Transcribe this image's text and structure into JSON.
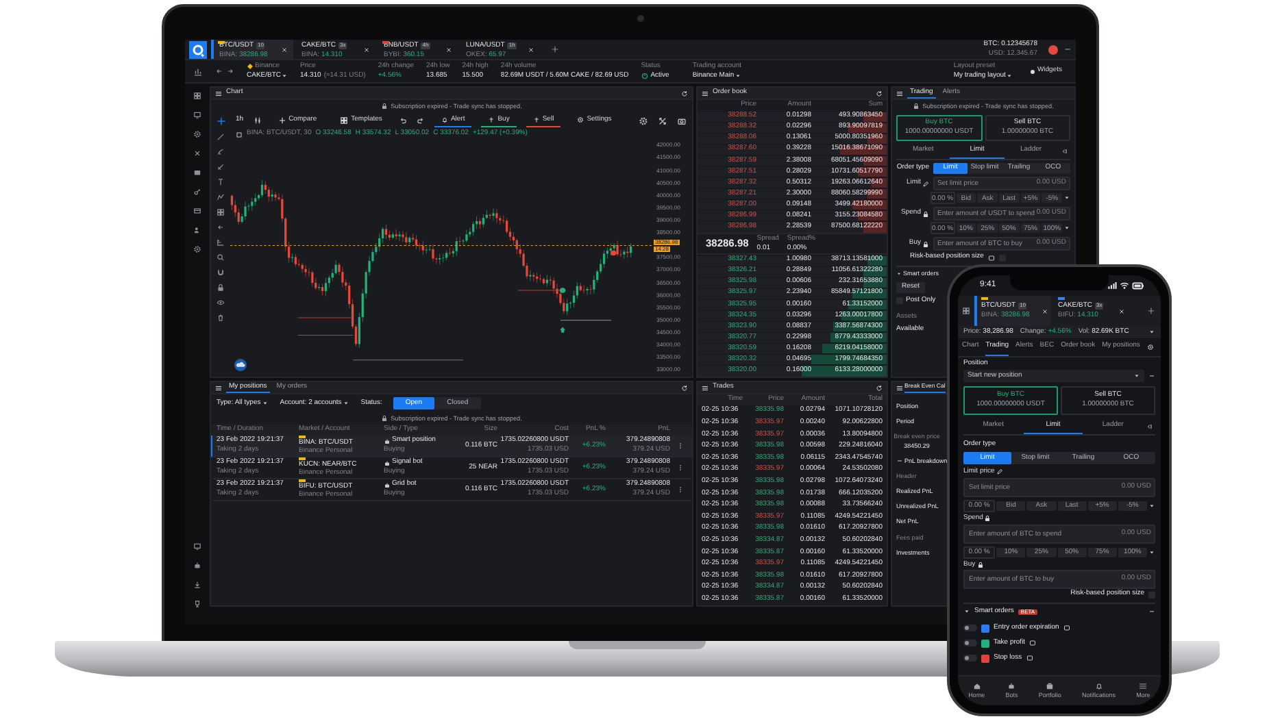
{
  "laptop": {
    "top_tabs": [
      {
        "pair": "BTC/USDT",
        "badge": "10",
        "exchange": "BINA:",
        "price": "38286.98",
        "color": "#f0b90b",
        "selected": true
      },
      {
        "pair": "CAKE/BTC",
        "badge": "3x",
        "exchange": "BINA:",
        "price": "14.310",
        "selected": false
      },
      {
        "pair": "BNB/USDT",
        "badge": "4h",
        "exchange": "BYBI:",
        "price": "360.15",
        "color": "#e0443a",
        "selected": false
      },
      {
        "pair": "LUNA/USDT",
        "badge": "1h",
        "exchange": "OKEX:",
        "price": "65.97",
        "selected": false
      }
    ],
    "balance": [
      "BTC: 0.12345678",
      "USD: 12,345.67"
    ],
    "info_bar": {
      "exchange": "Binance",
      "pair": "CAKE/BTC",
      "stats": [
        {
          "label": "Price",
          "value": "14.310",
          "note": "(≈14.31 USD)",
          "kind": "plain"
        },
        {
          "label": "24h change",
          "value": "+4.56%",
          "kind": "up"
        },
        {
          "label": "24h low",
          "value": "13.685",
          "kind": "plain"
        },
        {
          "label": "24h high",
          "value": "15.500",
          "kind": "plain"
        },
        {
          "label": "24h volume",
          "value": "82.69M USDT / 5.60M CAKE / 82.69 USD",
          "kind": "plain"
        }
      ],
      "status_label": "Status",
      "status": "Active",
      "account_label": "Trading account",
      "account": "Binance Main",
      "layout_label": "Layout preset",
      "layout": "My trading layout",
      "widgets": "Widgets"
    },
    "chart": {
      "title": "Chart",
      "notice": "Subscription expired - Trade sync has stopped.",
      "interval": "1h",
      "tools": [
        "Compare",
        "Templates"
      ],
      "actions": [
        {
          "label": "Alert",
          "kind": "alert"
        },
        {
          "label": "Buy",
          "kind": "buy"
        },
        {
          "label": "Sell",
          "kind": "sell"
        },
        {
          "label": "Settings",
          "kind": "settings"
        }
      ],
      "symbol": "BINA: BTC/USDT, 30",
      "ohlc": [
        "O 33246.58",
        "H 33574.32",
        "L 33050.02",
        "C 33376.02",
        "+129.47 (+0.39%)"
      ],
      "price_axis_upper": [
        "42000.00",
        "41500.00",
        "41000.00",
        "40500.00",
        "40000.00",
        "39500.00",
        "39000.00",
        "38500.00"
      ],
      "price_axis_lower": [
        "37500.00",
        "37000.00",
        "36500.00",
        "36000.00",
        "35500.00",
        "35000.00",
        "34500.00",
        "34000.00",
        "33500.00",
        "33000.00"
      ],
      "last_price": "38286.98",
      "countdown": "14:28"
    },
    "order_book": {
      "title": "Order book",
      "columns": [
        "Price",
        "Amount",
        "Sum"
      ],
      "asks": [
        {
          "price": "38288.52",
          "amount": "0.01298",
          "sum": "493.90863450",
          "level": 0.12
        },
        {
          "price": "38288.32",
          "amount": "0.02296",
          "sum": "893.90097819",
          "level": 0.2
        },
        {
          "price": "38288.06",
          "amount": "0.13061",
          "sum": "5000.80351960",
          "level": 0.1
        },
        {
          "price": "38287.60",
          "amount": "0.39228",
          "sum": "15016.38671090",
          "level": 0.25
        },
        {
          "price": "38287.59",
          "amount": "2.38008",
          "sum": "68051.45609090",
          "level": 0.12
        },
        {
          "price": "38287.51",
          "amount": "0.28029",
          "sum": "10731.60517790",
          "level": 0.15
        },
        {
          "price": "38287.32",
          "amount": "0.50312",
          "sum": "19263.06612640",
          "level": 0.08
        },
        {
          "price": "38287.21",
          "amount": "2.30000",
          "sum": "88060.58299990",
          "level": 0.1
        },
        {
          "price": "38287.00",
          "amount": "0.09148",
          "sum": "3499.42180000",
          "level": 0.18
        },
        {
          "price": "38286.99",
          "amount": "0.08241",
          "sum": "3155.23084580",
          "level": 0.15
        },
        {
          "price": "38286.98",
          "amount": "2.28539",
          "sum": "87500.68122220",
          "level": 0.12
        }
      ],
      "mid": {
        "price": "38286.98",
        "spread_label": "Spread",
        "spread": "0.01",
        "pct_label": "Spread%",
        "pct": "0.00%"
      },
      "bids": [
        {
          "price": "38327.43",
          "amount": "1.00980",
          "sum": "38713.13581000",
          "level": 0.1
        },
        {
          "price": "38326.21",
          "amount": "0.28849",
          "sum": "11056.61322280",
          "level": 0.12
        },
        {
          "price": "38325.98",
          "amount": "0.00606",
          "sum": "232.31653880",
          "level": 0.12
        },
        {
          "price": "38325.97",
          "amount": "2.23940",
          "sum": "85849.57121800",
          "level": 0.18
        },
        {
          "price": "38325.95",
          "amount": "0.00160",
          "sum": "61.33152000",
          "level": 0.2
        },
        {
          "price": "38324.35",
          "amount": "0.03296",
          "sum": "1263.00017800",
          "level": 0.24
        },
        {
          "price": "38323.90",
          "amount": "0.08837",
          "sum": "3387.56874300",
          "level": 0.28
        },
        {
          "price": "38320.77",
          "amount": "0.22998",
          "sum": "8779.43333000",
          "level": 0.3
        },
        {
          "price": "38320.59",
          "amount": "0.16208",
          "sum": "6219.04158000",
          "level": 0.34
        },
        {
          "price": "38320.32",
          "amount": "0.04695",
          "sum": "1799.74684350",
          "level": 0.4
        },
        {
          "price": "38320.00",
          "amount": "0.16000",
          "sum": "6133.28000000",
          "level": 0.45
        }
      ]
    },
    "trading": {
      "tabs": [
        {
          "label": "Trading",
          "selected": true
        },
        {
          "label": "Alerts",
          "selected": false
        }
      ],
      "notice": "Subscription expired - Trade sync has stopped.",
      "sides": [
        {
          "label": "Buy BTC",
          "amount": "1000.00000000 USDT",
          "selected": true
        },
        {
          "label": "Sell BTC",
          "amount": "1.00000000 BTC",
          "selected": false
        }
      ],
      "modes": [
        {
          "label": "Market",
          "selected": false
        },
        {
          "label": "Limit",
          "selected": true
        },
        {
          "label": "Ladder",
          "selected": false
        }
      ],
      "order_type_label": "Order type",
      "order_types": [
        {
          "label": "Limit",
          "selected": true
        },
        {
          "label": "Stop limit",
          "selected": false
        },
        {
          "label": "Trailing",
          "selected": false
        },
        {
          "label": "OCO",
          "selected": false
        }
      ],
      "fields": [
        {
          "label": "Limit",
          "placeholder": "Set limit price",
          "unit": "0.00 USD",
          "chips": [
            "0.00 %",
            "Bid",
            "Ask",
            "Last",
            "+5%",
            "-5%"
          ]
        },
        {
          "label": "Spend",
          "placeholder": "Enter amount of USDT to spend",
          "unit": "0.00 USD",
          "chips": [
            "0.00 %",
            "10%",
            "25%",
            "50%",
            "75%",
            "100%"
          ]
        },
        {
          "label": "Buy",
          "placeholder": "Enter amount of BTC to buy",
          "unit": "0.00 USD"
        }
      ],
      "risk_label": "Risk-based position size",
      "risk_checked": false,
      "smart_orders": "Smart orders",
      "reset": "Reset",
      "post_only": "Post Only",
      "post_only_checked": false,
      "assets": "Assets",
      "available": "Available"
    },
    "positions": {
      "tabs": [
        {
          "label": "My positions",
          "selected": true
        },
        {
          "label": "My orders",
          "selected": false
        }
      ],
      "filters": [
        "Type: All types",
        "Account: 2 accounts"
      ],
      "status_label": "Status:",
      "status_options": [
        {
          "label": "Open",
          "selected": true
        },
        {
          "label": "Closed",
          "selected": false
        }
      ],
      "notice": "Subscription expired - Trade sync has stopped.",
      "columns": [
        "Time / Duration",
        "Market / Account",
        "Side / Type",
        "Size",
        "Cost",
        "PnL %",
        "PnL"
      ],
      "rows": [
        {
          "time": "23 Feb 2022 19:21:37",
          "duration": "Taking 2 days",
          "market": "BINA: BTC/USDT",
          "account": "Binance Personal",
          "color": "#f0b90b",
          "type": "Smart position",
          "side": "Buying",
          "size": "0.116 BTC",
          "cost": "1735.02260800 USDT",
          "cost_usd": "1735.03 USD",
          "pnl_pct": "+6.23%",
          "pnl": "379.24890808",
          "pnl_usd": "379.24 USD",
          "selected": true
        },
        {
          "time": "23 Feb 2022 19:21:37",
          "duration": "Taking 2 days",
          "market": "KUCN: NEAR/BTC",
          "account": "Binance Personal",
          "color": "#f0b90b",
          "type": "Signal bot",
          "side": "Buying",
          "size": "25 NEAR",
          "cost": "1735.02260800 USDT",
          "cost_usd": "1735.03 USD",
          "pnl_pct": "+6.23%",
          "pnl": "379.24890808",
          "pnl_usd": "379.24 USD",
          "selected": false
        },
        {
          "time": "23 Feb 2022 19:21:37",
          "duration": "Taking 2 days",
          "market": "BIFU: BTC/USDT",
          "account": "Binance Personal",
          "color": "#f0b90b",
          "type": "Grid bot",
          "side": "Buying",
          "size": "0.116 BTC",
          "cost": "1735.02260800 USDT",
          "cost_usd": "1735.03 USD",
          "pnl_pct": "+6.23%",
          "pnl": "379.24890808",
          "pnl_usd": "379.24 USD",
          "selected": false
        }
      ]
    },
    "trades": {
      "title": "Trades",
      "columns": [
        "Time",
        "Price",
        "Amount",
        "Total"
      ],
      "rows": [
        {
          "time": "02-25 10:36",
          "price": "38335.98",
          "kind": "buy",
          "amount": "0.02794",
          "total": "1071.10728120"
        },
        {
          "time": "02-25 10:36",
          "price": "38335.97",
          "kind": "sell",
          "amount": "0.00240",
          "total": "92.00622800"
        },
        {
          "time": "02-25 10:36",
          "price": "38335.97",
          "kind": "sell",
          "amount": "0.00036",
          "total": "13.80094800"
        },
        {
          "time": "02-25 10:36",
          "price": "38335.98",
          "kind": "buy",
          "amount": "0.00598",
          "total": "229.24816040"
        },
        {
          "time": "02-25 10:36",
          "price": "38335.98",
          "kind": "buy",
          "amount": "0.06115",
          "total": "2343.47545740"
        },
        {
          "time": "02-25 10:36",
          "price": "38335.97",
          "kind": "sell",
          "amount": "0.00064",
          "total": "24.53502080"
        },
        {
          "time": "02-25 10:36",
          "price": "38335.98",
          "kind": "buy",
          "amount": "0.02798",
          "total": "1072.64073240"
        },
        {
          "time": "02-25 10:36",
          "price": "38335.98",
          "kind": "buy",
          "amount": "0.01738",
          "total": "666.12035200"
        },
        {
          "time": "02-25 10:36",
          "price": "38335.98",
          "kind": "buy",
          "amount": "0.00088",
          "total": "33.73566240"
        },
        {
          "time": "02-25 10:36",
          "price": "38335.97",
          "kind": "sell",
          "amount": "0.11085",
          "total": "4249.54221450"
        },
        {
          "time": "02-25 10:36",
          "price": "38335.98",
          "kind": "buy",
          "amount": "0.01610",
          "total": "617.20927800"
        },
        {
          "time": "02-25 10:36",
          "price": "38334.87",
          "kind": "buy",
          "amount": "0.00132",
          "total": "50.60202840"
        },
        {
          "time": "02-25 10:36",
          "price": "38335.87",
          "kind": "buy",
          "amount": "0.00160",
          "total": "61.33520000"
        },
        {
          "time": "02-25 10:36",
          "price": "38335.97",
          "kind": "sell",
          "amount": "0.11085",
          "total": "4249.54221450"
        },
        {
          "time": "02-25 10:36",
          "price": "38335.98",
          "kind": "buy",
          "amount": "0.01610",
          "total": "617.20927800"
        },
        {
          "time": "02-25 10:36",
          "price": "38334.87",
          "kind": "buy",
          "amount": "0.00132",
          "total": "50.60202840"
        },
        {
          "time": "02-25 10:36",
          "price": "38335.87",
          "kind": "buy",
          "amount": "0.00160",
          "total": "61.33520000"
        }
      ]
    },
    "break_even": {
      "title": "Break Even Cal",
      "position_label": "Position",
      "period_label": "Period",
      "result_label": "Break even price",
      "result": "38450.29",
      "breakdown": "PnL breakdown",
      "header": "Header",
      "rows": [
        "Realized PnL",
        "Unrealized PnL",
        "Net PnL",
        "Fees paid",
        "Investments"
      ]
    }
  },
  "phone": {
    "time": "9:41",
    "tabs": [
      {
        "pair": "BTC/USDT",
        "badge": "10",
        "exchange": "BINA:",
        "price": "38286.98",
        "color": "#f0b90b",
        "selected": true
      },
      {
        "pair": "CAKE/BTC",
        "badge": "3x",
        "exchange": "BIFU:",
        "price": "14.310",
        "color": "#3b82f6",
        "selected": false
      }
    ],
    "ticker": [
      {
        "label": "Price:",
        "value": "38,286.98",
        "kind": "plain"
      },
      {
        "label": "Change:",
        "value": "+4.56%",
        "kind": "up"
      },
      {
        "label": "Vol:",
        "value": "82.69K BTC",
        "kind": "plain"
      }
    ],
    "nav": [
      {
        "label": "Chart",
        "selected": false
      },
      {
        "label": "Trading",
        "selected": true
      },
      {
        "label": "Alerts",
        "selected": false
      },
      {
        "label": "BEC",
        "selected": false
      },
      {
        "label": "Order book",
        "selected": false
      },
      {
        "label": "My positions",
        "selected": false
      }
    ],
    "position_label": "Position",
    "position": "Start new position",
    "sides": [
      {
        "label": "Buy BTC",
        "amount": "1000.00000000 USDT",
        "selected": true
      },
      {
        "label": "Sell BTC",
        "amount": "1.00000000 BTC",
        "selected": false
      }
    ],
    "modes": [
      {
        "label": "Market",
        "selected": false
      },
      {
        "label": "Limit",
        "selected": true
      },
      {
        "label": "Ladder",
        "selected": false
      }
    ],
    "order_type_label": "Order type",
    "order_types": [
      {
        "label": "Limit",
        "selected": true
      },
      {
        "label": "Stop limit",
        "selected": false
      },
      {
        "label": "Trailing",
        "selected": false
      },
      {
        "label": "OCO",
        "selected": false
      }
    ],
    "fields": [
      {
        "label": "Limit price",
        "placeholder": "Set limit price",
        "unit": "0.00 USD",
        "chips": [
          "0.00 %",
          "Bid",
          "Ask",
          "Last",
          "+5%",
          "-5%"
        ]
      },
      {
        "label": "Spend",
        "placeholder": "Enter amount of BTC to spend",
        "unit": "0.00 USD",
        "chips": [
          "0.00 %",
          "10%",
          "25%",
          "50%",
          "75%",
          "100%"
        ]
      },
      {
        "label": "Buy",
        "placeholder": "Enter amount of BTC to buy",
        "unit": "0.00 USD"
      }
    ],
    "risk_label": "Risk-based position size",
    "risk_checked": false,
    "smart_orders": "Smart orders",
    "beta": "BETA",
    "smart_items": [
      {
        "label": "Entry order expiration",
        "color": "#2f7bf6",
        "on": false
      },
      {
        "label": "Take profit",
        "color": "#22b07d",
        "on": false
      },
      {
        "label": "Stop loss",
        "color": "#e0443a",
        "on": false
      }
    ],
    "bottom_nav": [
      "Home",
      "Bots",
      "Portfolio",
      "Notifications",
      "More"
    ]
  }
}
